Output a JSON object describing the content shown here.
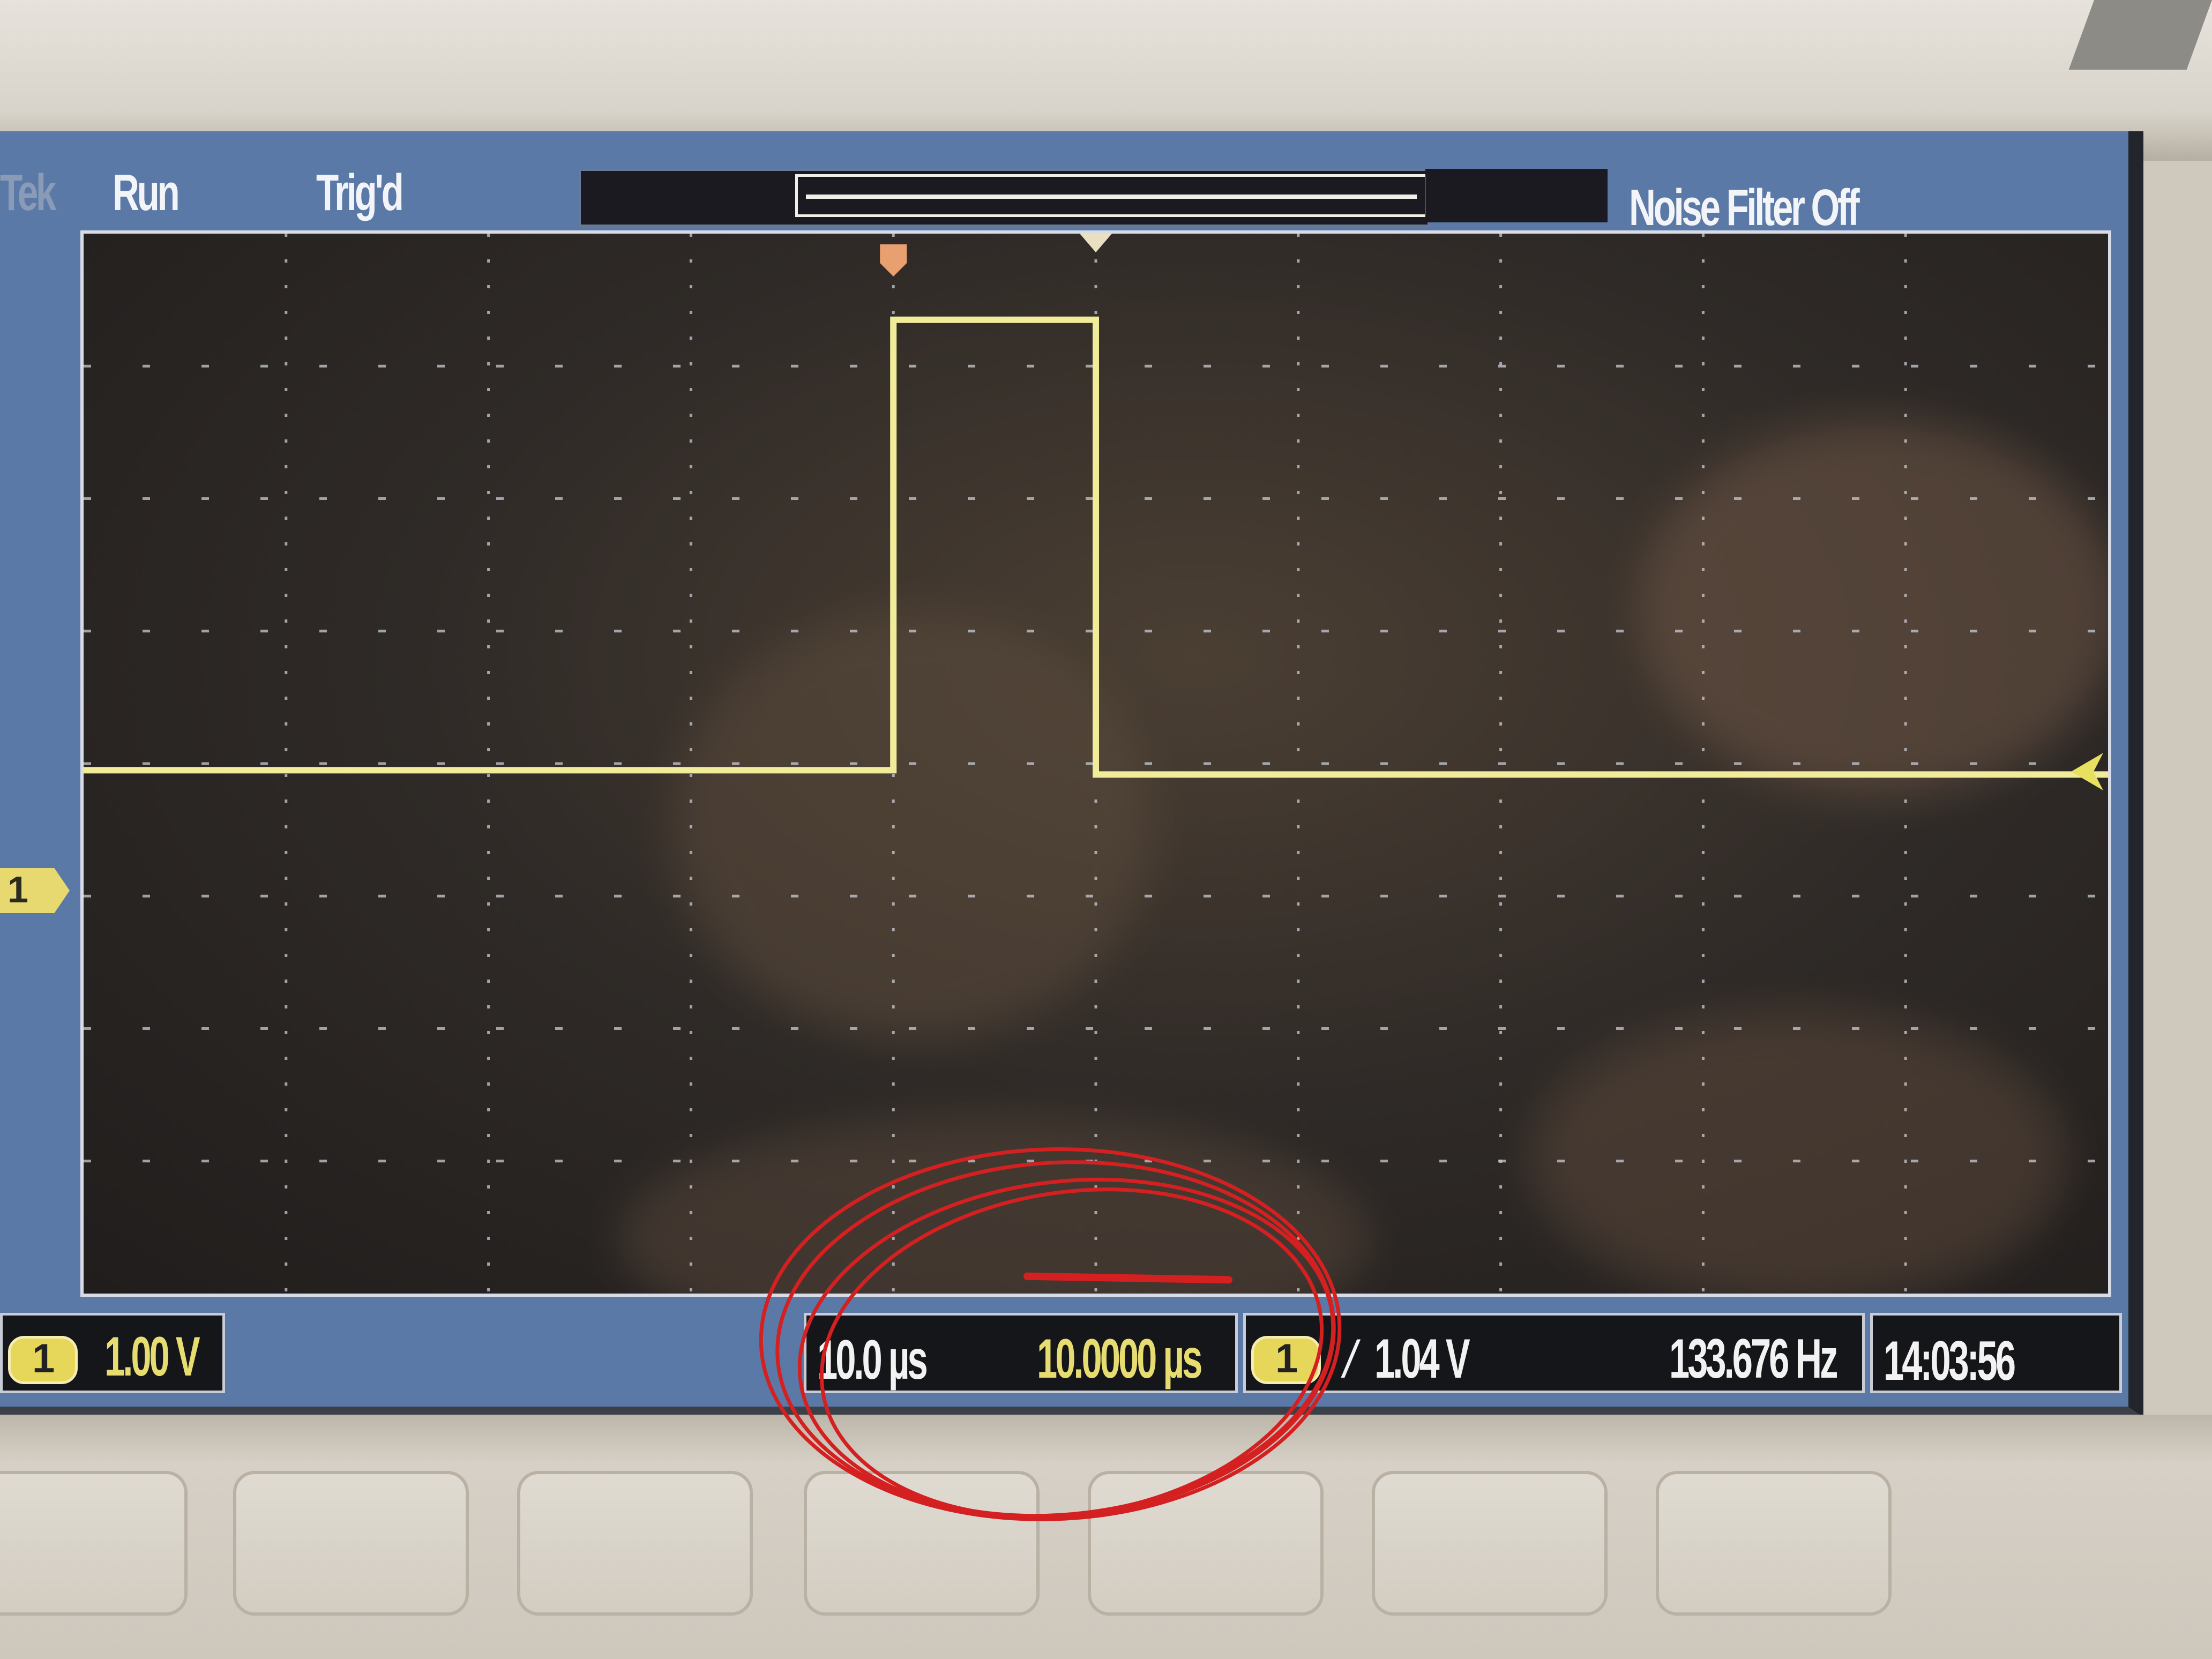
{
  "status": {
    "brand": "Tek",
    "acquisition": "Run",
    "trigger_state": "Trig'd",
    "noise_filter": "Noise Filter Off"
  },
  "channel": {
    "number": "1",
    "scale": "1.00 V"
  },
  "timebase": {
    "scale": "10.0 µs",
    "position": "10.0000 µs"
  },
  "trigger": {
    "slope": "∕",
    "level": "1.04 V",
    "frequency": "133.676 Hz"
  },
  "clock": "14:03:56",
  "waveform": {
    "color": "#f0ec9a",
    "baseline_div": 3.95,
    "pulse_high_div": 7.35,
    "pulse_start_div": 4.0,
    "pulse_end_div": 5.0
  },
  "annotation": {
    "ink_color": "#d42020"
  }
}
